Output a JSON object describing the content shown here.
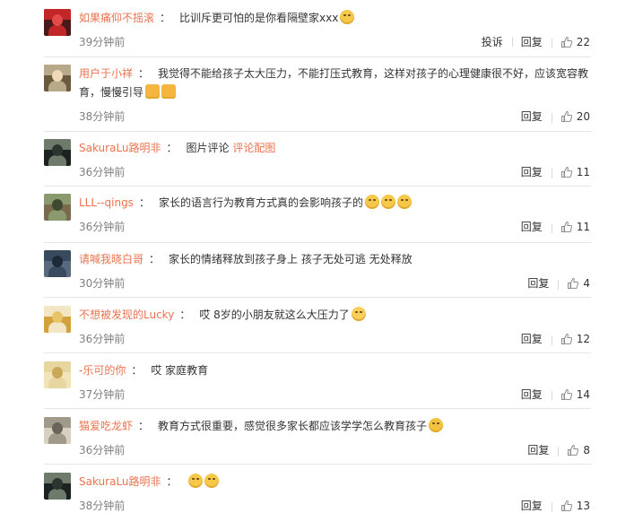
{
  "comments": [
    {
      "user": "如果痛仰不摇滚",
      "segments": [
        {
          "t": "比训斥更可怕的是你看隔壁家xxx"
        }
      ],
      "emojis": [
        "emoji-smile"
      ],
      "time": "39分钟前",
      "report": "投诉",
      "reply": "回复",
      "likes": "22",
      "avatar_colors": [
        "#c22626",
        "#e34a4a",
        "#4a1a1a"
      ]
    },
    {
      "user": "用户于小祥",
      "segments": [
        {
          "t": "我觉得不能给孩子太大压力，不能打压式教育，这样对孩子的心理健康很不好，应该宽容教育，慢慢引导"
        }
      ],
      "emojis": [
        "emoji-pray",
        "emoji-pray"
      ],
      "time": "38分钟前",
      "reply": "回复",
      "likes": "20",
      "avatar_colors": [
        "#b8a98a",
        "#f0d9b8",
        "#6b5a40"
      ]
    },
    {
      "user": "SakuraLu路明非",
      "segments": [
        {
          "t": "图片评论 "
        },
        {
          "t": "评论配图",
          "link": true
        }
      ],
      "emojis": [],
      "time": "36分钟前",
      "reply": "回复",
      "likes": "11",
      "avatar_colors": [
        "#6e7a6a",
        "#2e3530",
        "#1c2220"
      ]
    },
    {
      "user": "LLL--qings",
      "segments": [
        {
          "t": "家长的语言行为教育方式真的会影响孩子的"
        }
      ],
      "emojis": [
        "emoji-think",
        "emoji-think",
        "emoji-think"
      ],
      "time": "36分钟前",
      "reply": "回复",
      "likes": "11",
      "avatar_colors": [
        "#8b9a6e",
        "#3d4a2f",
        "#7a6a4e"
      ]
    },
    {
      "user": "请喊我晓白哥",
      "segments": [
        {
          "t": "家长的情绪释放到孩子身上 孩子无处可逃 无处释放"
        }
      ],
      "emojis": [],
      "time": "30分钟前",
      "reply": "回复",
      "likes": "4",
      "avatar_colors": [
        "#3a4a5e",
        "#1e2a38",
        "#5a6a7e"
      ]
    },
    {
      "user": "不想被发现的Lucky",
      "segments": [
        {
          "t": "哎 8岁的小朋友就这么大压力了"
        }
      ],
      "emojis": [
        "emoji-cry"
      ],
      "time": "36分钟前",
      "reply": "回复",
      "likes": "12",
      "avatar_colors": [
        "#f2e6c4",
        "#e8c46a",
        "#d4a23c"
      ]
    },
    {
      "user": "-乐可的你",
      "segments": [
        {
          "t": "哎 家庭教育"
        }
      ],
      "emojis": [],
      "time": "37分钟前",
      "reply": "回复",
      "likes": "14",
      "avatar_colors": [
        "#e8d6a0",
        "#c9a85a",
        "#f2e4b8"
      ]
    },
    {
      "user": "猫爱吃龙虾",
      "segments": [
        {
          "t": "教育方式很重要，感觉很多家长都应该学学怎么教育孩子"
        }
      ],
      "emojis": [
        "emoji-laugh"
      ],
      "time": "36分钟前",
      "reply": "回复",
      "likes": "8",
      "avatar_colors": [
        "#a09a8a",
        "#6a645a",
        "#d8d0c0"
      ]
    },
    {
      "user": "SakuraLu路明非",
      "segments": [],
      "emojis": [
        "emoji-think",
        "emoji-think"
      ],
      "time": "38分钟前",
      "reply": "回复",
      "likes": "13",
      "avatar_colors": [
        "#6e7a6a",
        "#2e3530",
        "#1c2220"
      ]
    }
  ],
  "colors": {
    "username": "#eb7350",
    "text": "#333333",
    "meta": "#808080",
    "divider": "#e6e6e6"
  }
}
